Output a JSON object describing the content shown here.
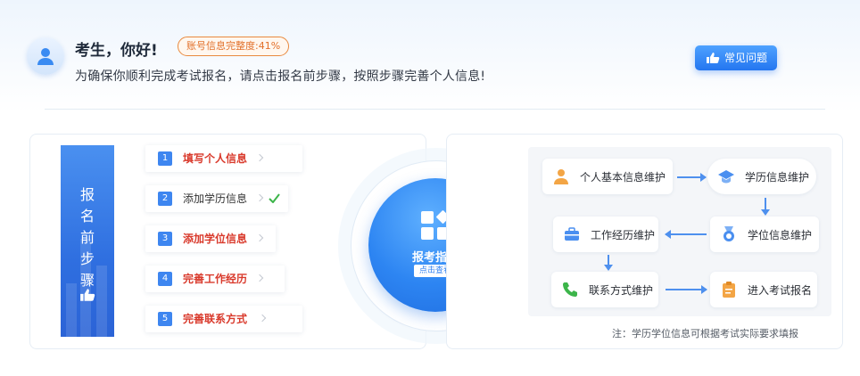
{
  "header": {
    "greeting": "考生，你好!",
    "completeness_badge": "账号信息完整度:41%",
    "subtitle": "为确保你顺利完成考试报名，请点击报名前步骤，按照步骤完善个人信息!",
    "faq_button": "常见问题"
  },
  "left_panel": {
    "banner_text": [
      "报",
      "名",
      "前",
      "步",
      "骤"
    ],
    "steps": [
      {
        "num": "1",
        "label": "填写个人信息",
        "status": "incomplete"
      },
      {
        "num": "2",
        "label": "添加学历信息",
        "status": "complete"
      },
      {
        "num": "3",
        "label": "添加学位信息",
        "status": "incomplete"
      },
      {
        "num": "4",
        "label": "完善工作经历",
        "status": "incomplete"
      },
      {
        "num": "5",
        "label": "完善联系方式",
        "status": "incomplete"
      }
    ]
  },
  "guide": {
    "title": "报考指南",
    "button": "点击查看"
  },
  "flow": {
    "nodes": {
      "personal": "个人基本信息维护",
      "education": "学历信息维护",
      "degree": "学位信息维护",
      "work": "工作经历维护",
      "contact": "联系方式维护",
      "enter": "进入考试报名"
    },
    "note": "注：学历学位信息可根据考试实际要求填报"
  },
  "colors": {
    "primary": "#2d7ff0",
    "incomplete_text": "#d93a2c",
    "badge": "#e2702a",
    "check": "#3cb54a"
  }
}
